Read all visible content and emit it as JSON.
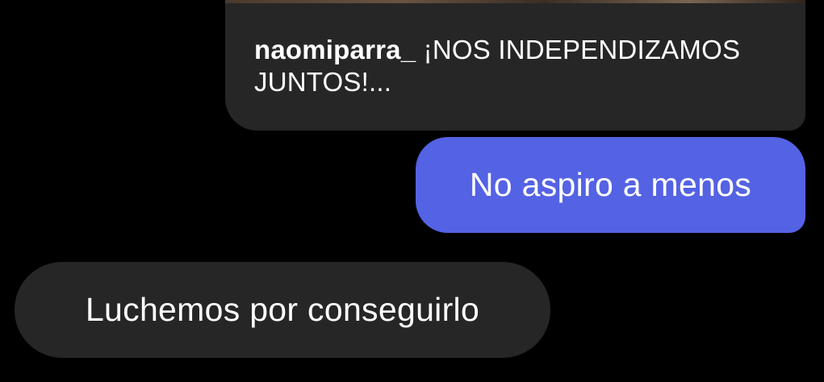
{
  "shared_post": {
    "author": "naomiparra_",
    "caption": "¡NOS INDEPENDIZAMOS JUNTOS!..."
  },
  "messages": [
    {
      "sender": "me",
      "text": "No aspiro a menos"
    },
    {
      "sender": "other",
      "text": "Luchemos por conseguirlo"
    }
  ],
  "colors": {
    "background": "#000000",
    "sent_bubble": "#5462e4",
    "received_bubble": "#262626",
    "text": "#ffffff"
  }
}
